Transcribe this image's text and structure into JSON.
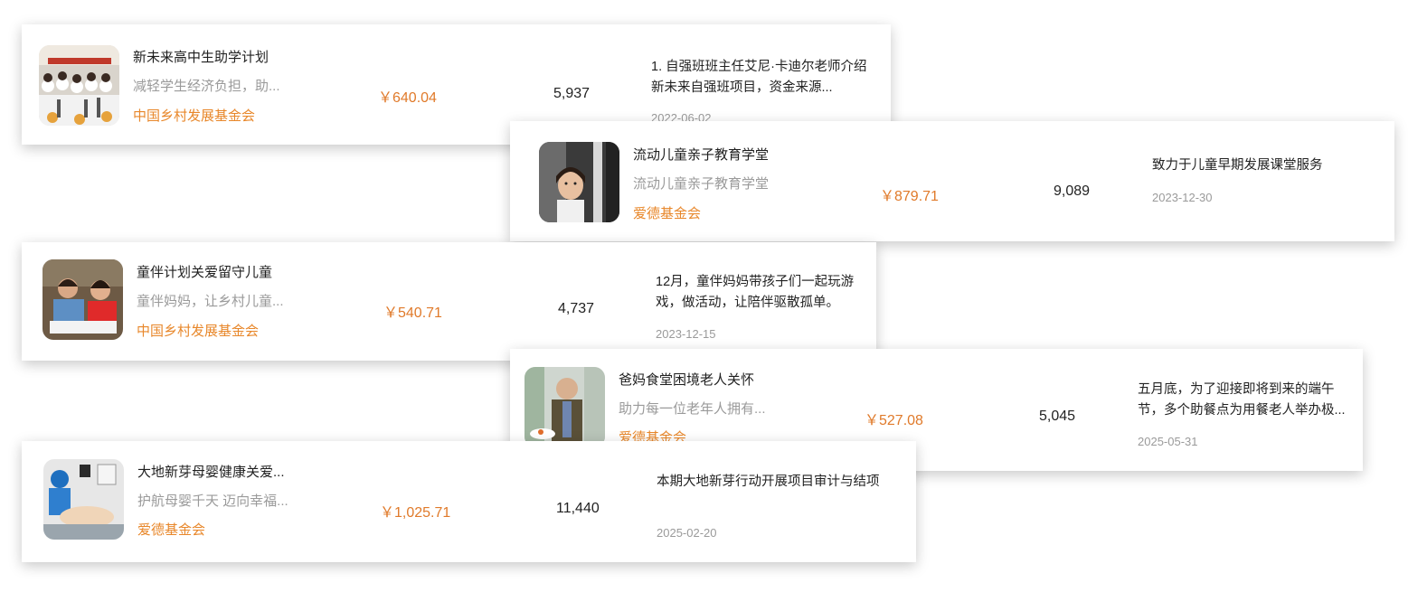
{
  "cards": [
    {
      "title": "新未来高中生助学计划",
      "subtitle": "减轻学生经济负担，助...",
      "org": "中国乡村发展基金会",
      "amount": "￥640.04",
      "count": "5,937",
      "update": "1. 自强班班主任艾尼·卡迪尔老师介绍新未来自强班项目，资金来源...",
      "date": "2022-06-02"
    },
    {
      "title": "流动儿童亲子教育学堂",
      "subtitle": "流动儿童亲子教育学堂",
      "org": "爱德基金会",
      "amount": "￥879.71",
      "count": "9,089",
      "update": "致力于儿童早期发展课堂服务",
      "date": "2023-12-30"
    },
    {
      "title": "童伴计划关爱留守儿童",
      "subtitle": "童伴妈妈，让乡村儿童...",
      "org": "中国乡村发展基金会",
      "amount": "￥540.71",
      "count": "4,737",
      "update": "12月，童伴妈妈带孩子们一起玩游戏，做活动，让陪伴驱散孤单。",
      "date": "2023-12-15"
    },
    {
      "title": "爸妈食堂困境老人关怀",
      "subtitle": "助力每一位老年人拥有...",
      "org": "爱德基金会",
      "amount": "￥527.08",
      "count": "5,045",
      "update": "五月底，为了迎接即将到来的端午节，多个助餐点为用餐老人举办极...",
      "date": "2025-05-31"
    },
    {
      "title": "大地新芽母婴健康关爱...",
      "subtitle": "护航母婴千天 迈向幸福...",
      "org": "爱德基金会",
      "amount": "￥1,025.71",
      "count": "11,440",
      "update": "本期大地新芽行动开展项目审计与结项",
      "date": "2025-02-20"
    }
  ]
}
